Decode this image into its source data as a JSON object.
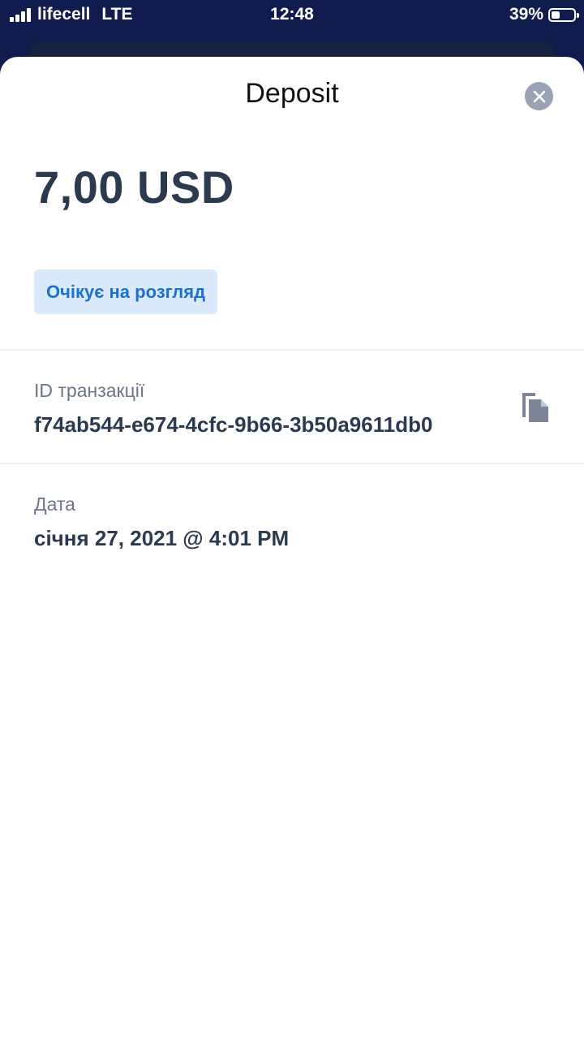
{
  "status_bar": {
    "carrier": "lifecell",
    "network": "LTE",
    "time": "12:48",
    "battery_percent": "39%",
    "battery_level": 0.39,
    "signal_bars": 4
  },
  "sheet": {
    "title": "Deposit",
    "close_icon": "close-icon",
    "amount": "7,00 USD",
    "status": "Очікує на розгляд",
    "transaction": {
      "label": "ID транзакції",
      "value": "f74ab544-e674-4cfc-9b66-3b50a9611db0",
      "copy_icon": "copy-icon"
    },
    "date": {
      "label": "Дата",
      "value": "січня 27, 2021 @ 4:01 PM"
    }
  },
  "colors": {
    "header_background": "#0f1c4d",
    "amount_text": "#2c3a50",
    "badge_background": "#dbeafb",
    "badge_text": "#1d6fd1",
    "close_button": "#9aa3b4",
    "copy_icon": "#7d8698"
  }
}
